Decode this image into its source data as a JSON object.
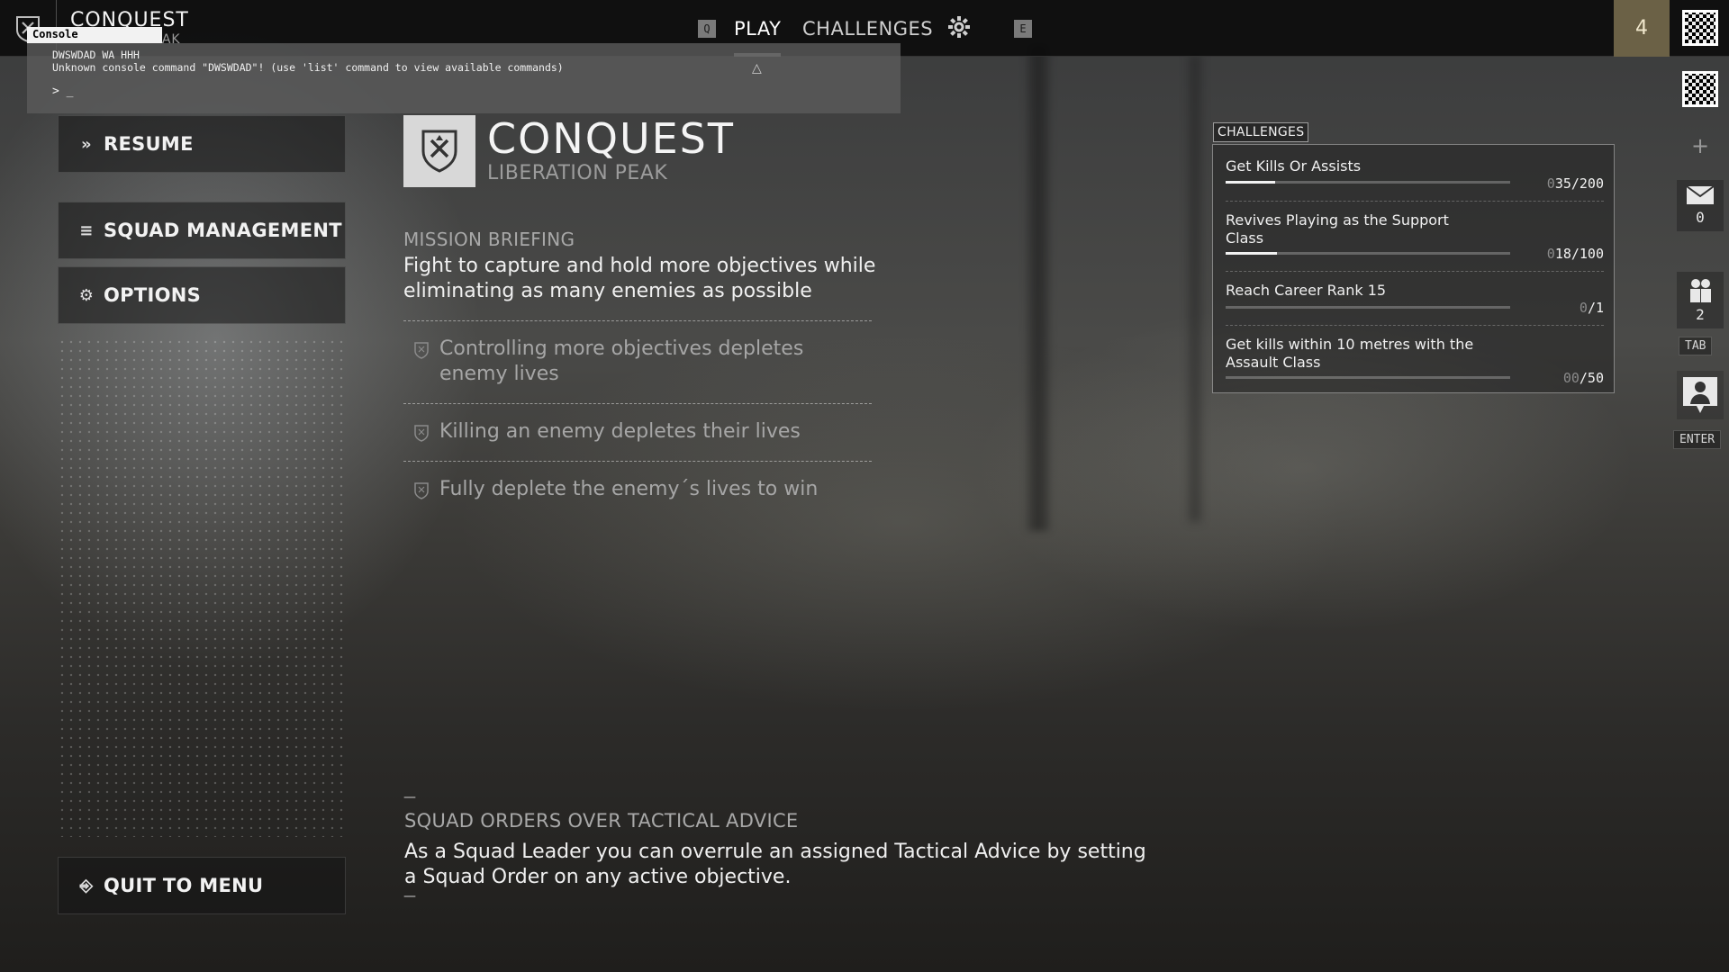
{
  "topbar": {
    "mode_title": "CONQUEST",
    "mode_sub": "EAK",
    "nav_left_key": "Q",
    "nav_play": "PLAY",
    "nav_challenges": "CHALLENGES",
    "nav_right_key": "E",
    "rank": "4"
  },
  "console": {
    "tag": "Console",
    "line1": "DWSWDAD WA HHH",
    "line2": "Unknown console command \"DWSWDAD\"! (use 'list' command to view available commands)",
    "prompt": "> _"
  },
  "menu": {
    "resume": "RESUME",
    "squad": "SQUAD MANAGEMENT",
    "options": "OPTIONS",
    "quit": "QUIT TO MENU"
  },
  "mode": {
    "title": "CONQUEST",
    "map": "LIBERATION PEAK",
    "briefing_head": "MISSION BRIEFING",
    "briefing_text": "Fight to capture and hold more objectives while eliminating as many enemies as possible",
    "rules": [
      "Controlling more objectives depletes enemy lives",
      "Killing an enemy depletes their lives",
      "Fully deplete the enemy´s lives to win"
    ]
  },
  "tip": {
    "dash": "—",
    "head": "SQUAD ORDERS OVER TACTICAL ADVICE",
    "text": "As a Squad Leader you can overrule an assigned Tactical Advice by setting a Squad Order on any active objective."
  },
  "challenges": {
    "tag": "CHALLENGES",
    "items": [
      {
        "name": "Get Kills Or Assists",
        "dim": "0",
        "value": "35/200",
        "progress": 0.175
      },
      {
        "name": "Revives Playing as the Support Class",
        "dim": "0",
        "value": "18/100",
        "progress": 0.18
      },
      {
        "name": "Reach Career Rank 15",
        "dim": "0",
        "value": "/1",
        "progress": 0
      },
      {
        "name": "Get kills within 10 metres with the Assault Class",
        "dim": "00",
        "value": "/50",
        "progress": 0
      }
    ]
  },
  "side": {
    "mail_count": "0",
    "squad_count": "2",
    "tab_key": "TAB",
    "enter_key": "ENTER"
  }
}
